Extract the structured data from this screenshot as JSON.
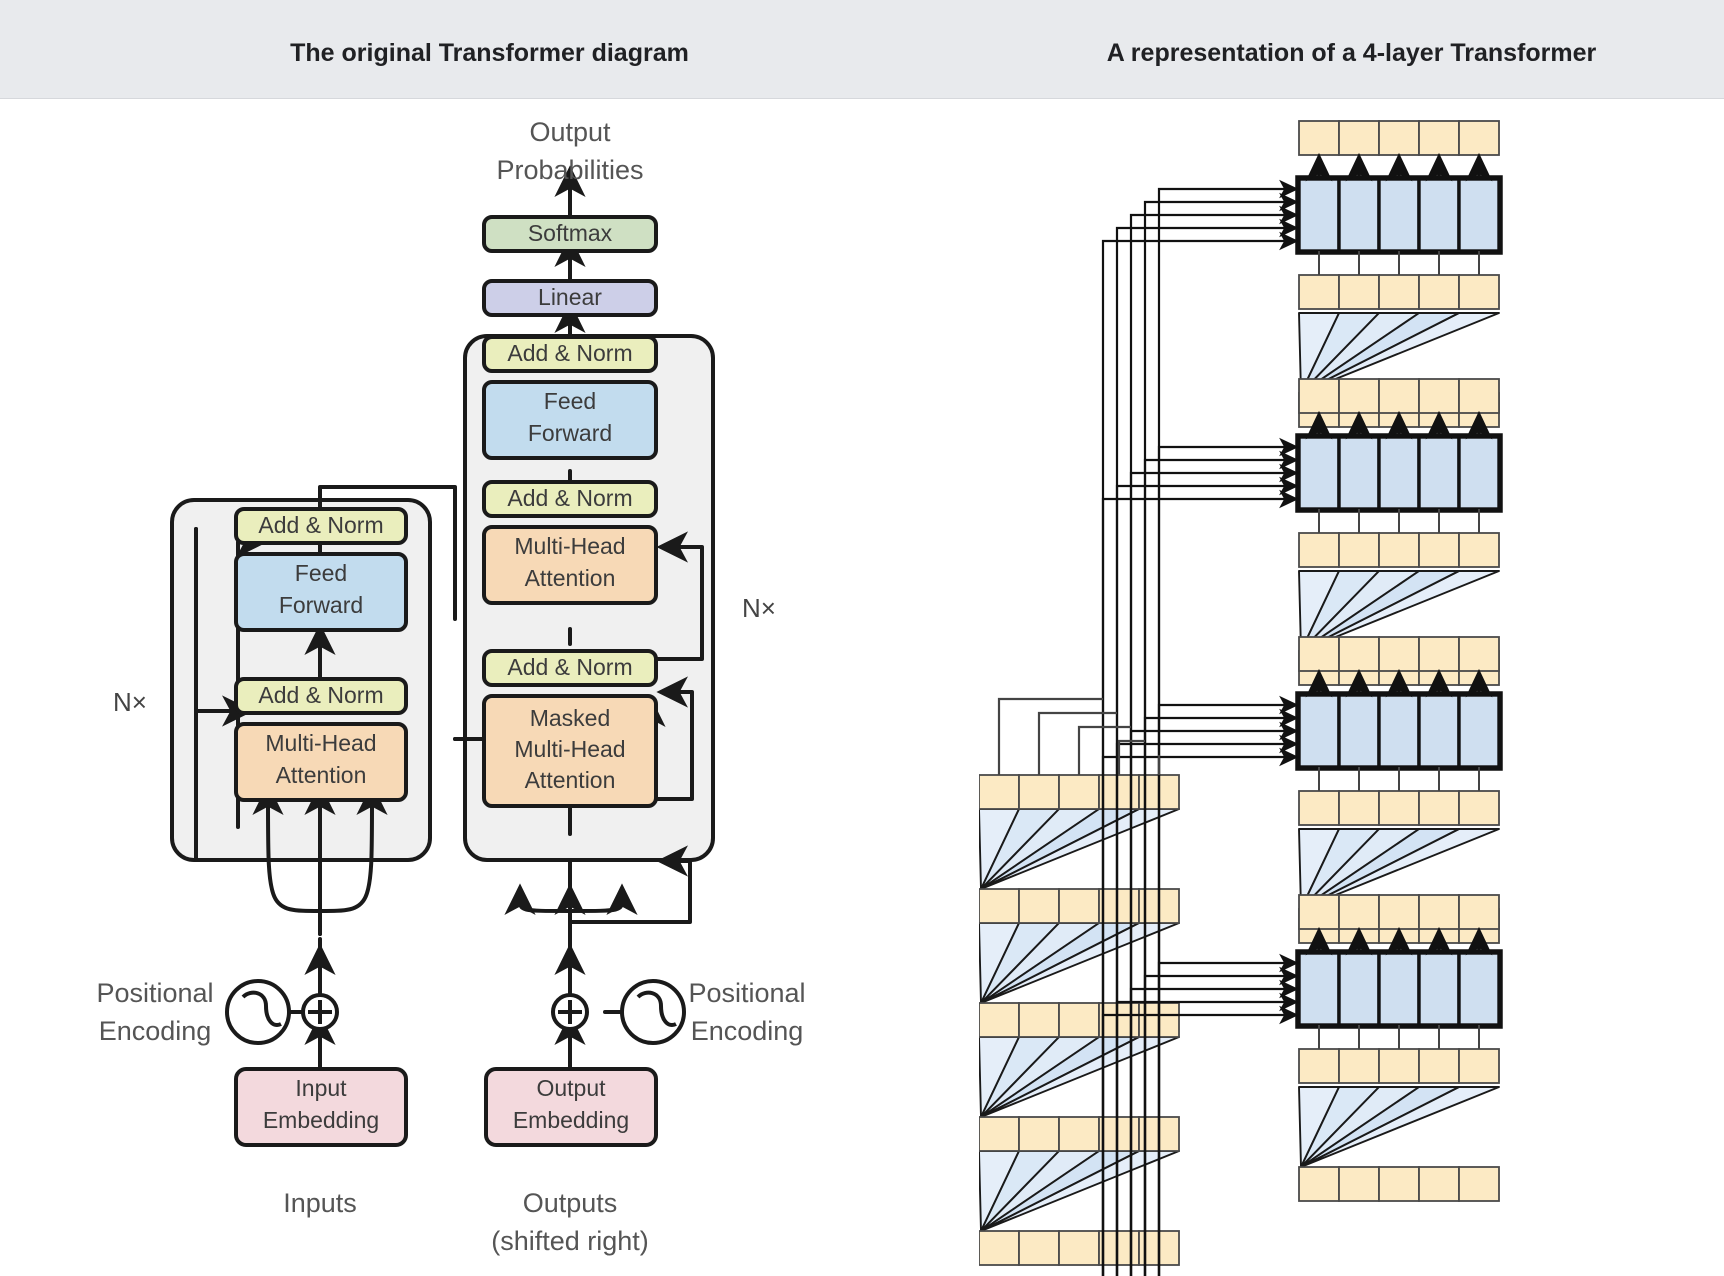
{
  "header": {
    "left_title": "The original Transformer diagram",
    "right_title": "A representation of a 4-layer Transformer"
  },
  "left_diagram": {
    "top_labels": {
      "line1": "Output",
      "line2": "Probabilities"
    },
    "blocks": {
      "softmax": "Softmax",
      "linear": "Linear",
      "add_norm": "Add & Norm",
      "feed_forward_line1": "Feed",
      "feed_forward_line2": "Forward",
      "multi_head_line1": "Multi-Head",
      "multi_head_line2": "Attention",
      "masked_line1": "Masked",
      "masked_line2": "Multi-Head",
      "masked_line3": "Attention",
      "input_embedding_line1": "Input",
      "input_embedding_line2": "Embedding",
      "output_embedding_line1": "Output",
      "output_embedding_line2": "Embedding"
    },
    "encoder": {
      "add_norm_top": "Add & Norm",
      "feed_forward_l1": "Feed",
      "feed_forward_l2": "Forward",
      "add_norm_bottom": "Add & Norm",
      "attention_l1": "Multi-Head",
      "attention_l2": "Attention",
      "repeat_label": "N×"
    },
    "decoder": {
      "add_norm_top": "Add & Norm",
      "feed_forward_l1": "Feed",
      "feed_forward_l2": "Forward",
      "add_norm_mid": "Add & Norm",
      "attention_l1": "Multi-Head",
      "attention_l2": "Attention",
      "add_norm_bottom": "Add & Norm",
      "masked_l1": "Masked",
      "masked_l2": "Multi-Head",
      "masked_l3": "Attention",
      "repeat_label": "N×"
    },
    "positional_left": {
      "line1": "Positional",
      "line2": "Encoding"
    },
    "positional_right": {
      "line1": "Positional",
      "line2": "Encoding"
    },
    "bottom_left": "Inputs",
    "bottom_right": {
      "line1": "Outputs",
      "line2": "(shifted right)"
    },
    "colors": {
      "softmax": "#cfe0c3",
      "linear": "#cdcfe8",
      "add_norm": "#eaeebd",
      "feed_forward": "#c2dcee",
      "attention": "#f7d9b6",
      "embedding": "#f3d9dd",
      "stage_panel": "#f0f0f0",
      "stroke": "#1a1a1a"
    }
  },
  "right_diagram": {
    "encoder_stack": {
      "layers": 4,
      "tokens_per_row": 5,
      "token_rows": 5,
      "attention_fans": 4
    },
    "decoder_stack": {
      "layers": 4,
      "tokens_per_row": 5,
      "token_rows": 5,
      "attention_fans": 4,
      "cross_attention_arrows_per_layer": 5
    },
    "colors": {
      "token_fill": "#fceac4",
      "token_stroke": "#4a4a4a",
      "block_fill": "#cfdff0",
      "block_stroke": "#111111",
      "fan_fill": "#a8c8ea",
      "fan_stroke": "#1a1a1a",
      "wire": "#444444"
    }
  }
}
